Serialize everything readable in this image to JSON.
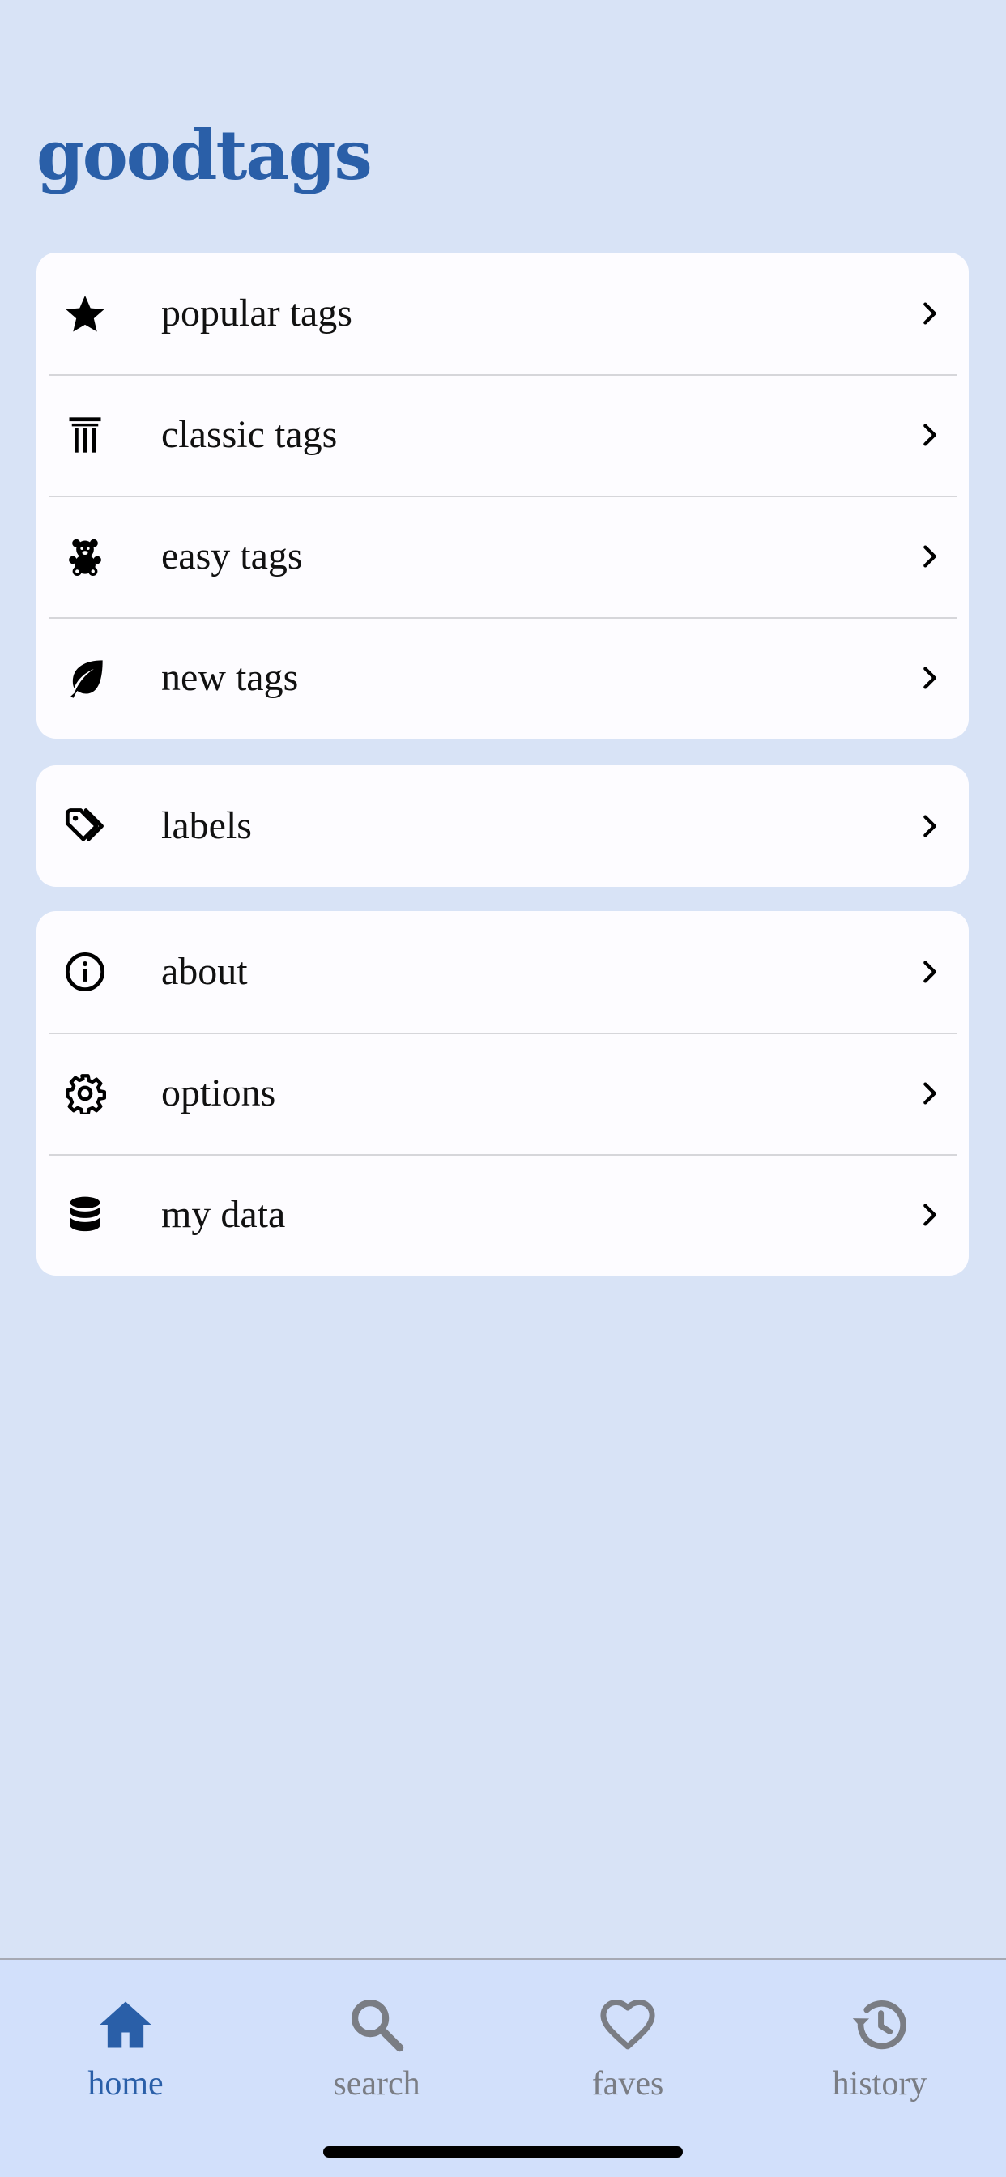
{
  "app": {
    "title": "goodtags"
  },
  "menu": {
    "primary": [
      {
        "label": "popular tags",
        "icon": "star-icon"
      },
      {
        "label": "classic tags",
        "icon": "column-icon"
      },
      {
        "label": "easy tags",
        "icon": "teddy-bear-icon"
      },
      {
        "label": "new tags",
        "icon": "leaf-icon"
      }
    ],
    "secondary": [
      {
        "label": "labels",
        "icon": "tags-icon"
      }
    ],
    "tertiary": [
      {
        "label": "about",
        "icon": "info-icon"
      },
      {
        "label": "options",
        "icon": "gear-icon"
      },
      {
        "label": "my data",
        "icon": "database-icon"
      }
    ]
  },
  "tabbar": {
    "tabs": [
      {
        "label": "home",
        "icon": "home-icon",
        "active": true
      },
      {
        "label": "search",
        "icon": "search-icon",
        "active": false
      },
      {
        "label": "faves",
        "icon": "heart-icon",
        "active": false
      },
      {
        "label": "history",
        "icon": "history-icon",
        "active": false
      }
    ]
  },
  "colors": {
    "background": "#d8e3f6",
    "accent": "#2a5fa8",
    "inactive": "#7a7d84",
    "card": "#fdfcff"
  }
}
